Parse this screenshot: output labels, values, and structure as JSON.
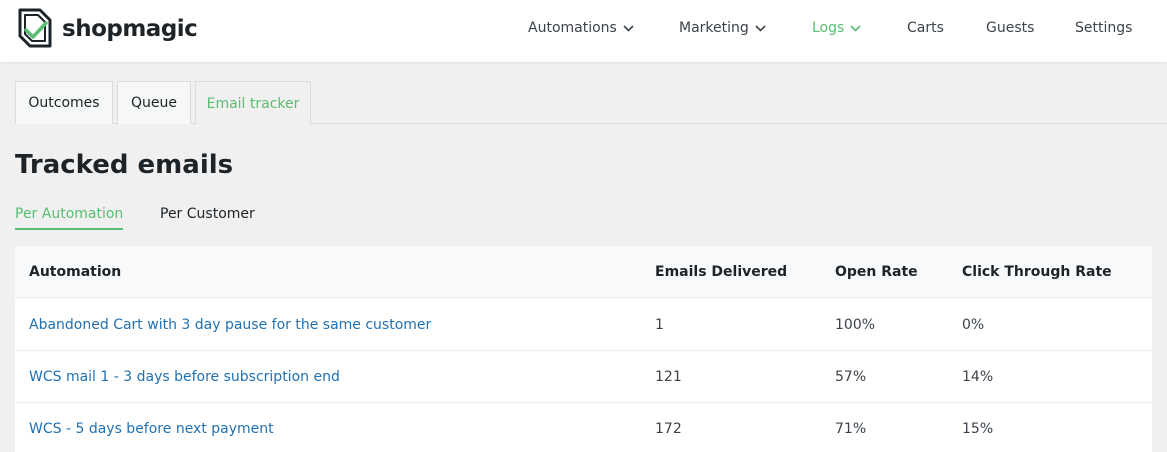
{
  "brand": {
    "name": "shopmagic",
    "accent": "#5bbd72",
    "link_color": "#2271b1"
  },
  "nav": {
    "items": [
      {
        "label": "Automations",
        "dropdown": true,
        "active": false
      },
      {
        "label": "Marketing",
        "dropdown": true,
        "active": false
      },
      {
        "label": "Logs",
        "dropdown": true,
        "active": true
      },
      {
        "label": "Carts",
        "dropdown": false,
        "active": false
      },
      {
        "label": "Guests",
        "dropdown": false,
        "active": false
      },
      {
        "label": "Settings",
        "dropdown": false,
        "active": false
      }
    ]
  },
  "tabs": [
    {
      "label": "Outcomes",
      "active": false
    },
    {
      "label": "Queue",
      "active": false
    },
    {
      "label": "Email tracker",
      "active": true
    }
  ],
  "page": {
    "title": "Tracked emails"
  },
  "subtabs": [
    {
      "label": "Per Automation",
      "active": true
    },
    {
      "label": "Per Customer",
      "active": false
    }
  ],
  "table": {
    "columns": [
      "Automation",
      "Emails Delivered",
      "Open Rate",
      "Click Through Rate"
    ],
    "rows": [
      {
        "automation": "Abandoned Cart with 3 day pause for the same customer",
        "delivered": "1",
        "open_rate": "100%",
        "ctr": "0%"
      },
      {
        "automation": "WCS mail 1 - 3 days before subscription end",
        "delivered": "121",
        "open_rate": "57%",
        "ctr": "14%"
      },
      {
        "automation": "WCS - 5 days before next payment",
        "delivered": "172",
        "open_rate": "71%",
        "ctr": "15%"
      }
    ]
  }
}
